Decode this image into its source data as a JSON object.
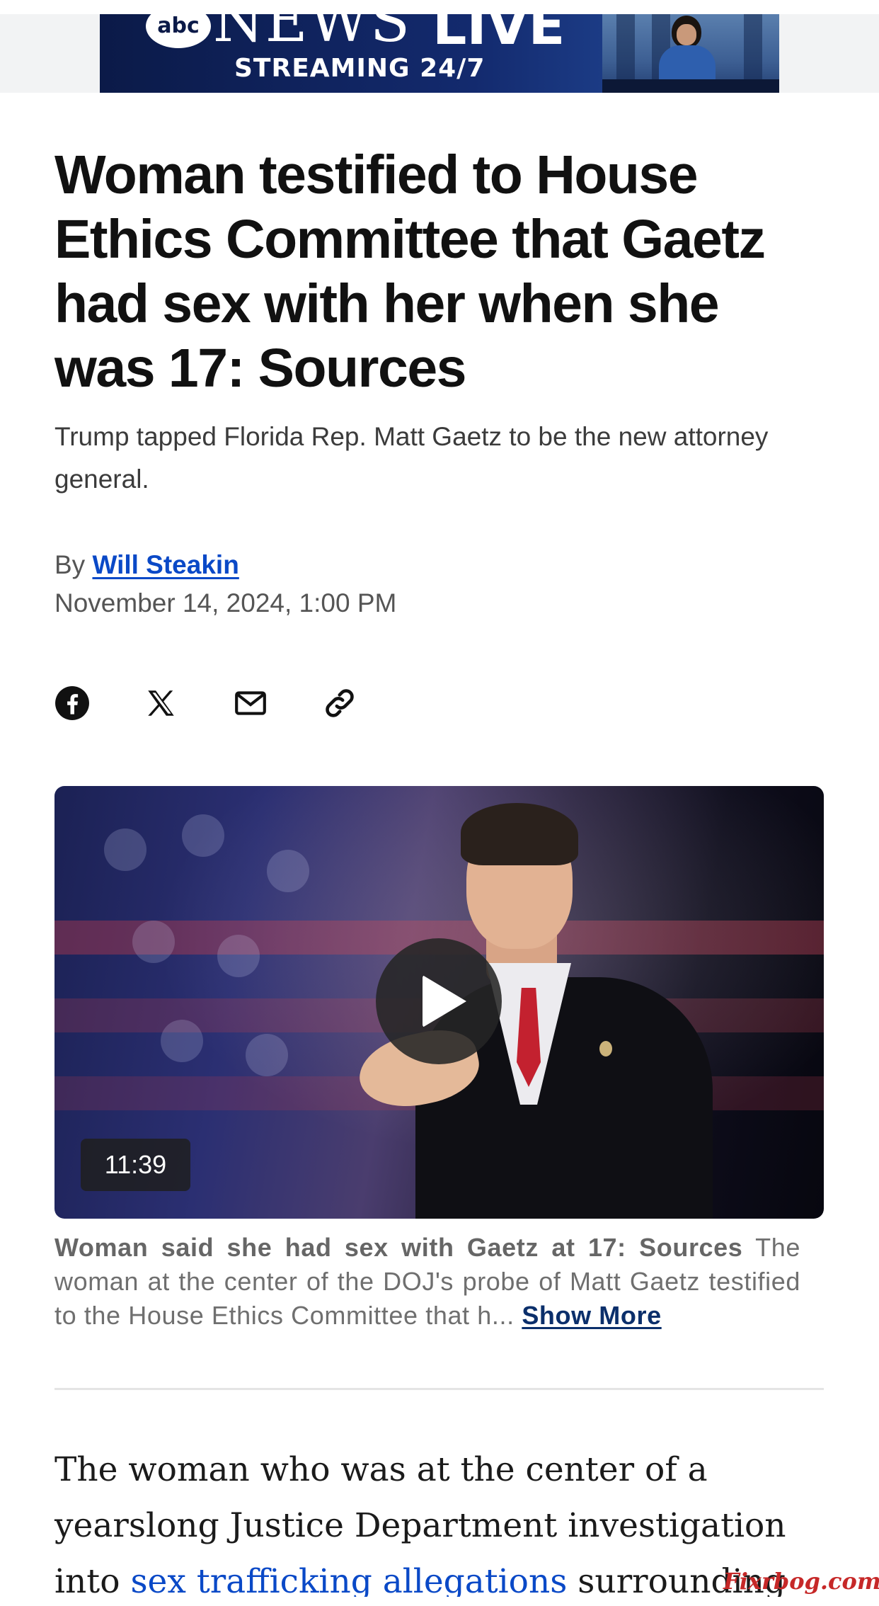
{
  "ad_banner": {
    "logo": "abc",
    "news": "NEWS",
    "live": "LIVE",
    "streaming": "STREAMING 24/7"
  },
  "article": {
    "headline": "Woman testified to House Ethics Committee that Gaetz had sex with her when she was 17: Sources",
    "subheadline": "Trump tapped Florida Rep. Matt Gaetz to be the new attorney general.",
    "byline_prefix": "By",
    "author": "Will Steakin",
    "date": "November 14, 2024, 1:00 PM"
  },
  "share_icons": [
    "facebook-icon",
    "x-icon",
    "email-icon",
    "link-icon"
  ],
  "video": {
    "duration": "11:39",
    "caption_title": "Woman said she had sex with Gaetz at 17: Sources",
    "caption_text": "The woman at the center of the DOJ's probe of Matt Gaetz testified to the House Ethics Committee that h...",
    "show_more_label": "Show More"
  },
  "body": {
    "text_before_link": "The woman who was at the center of a yearslong Justice Department investigation into ",
    "link_text": "sex trafficking allegations",
    "text_after_link": " surrounding Rep. Matt"
  },
  "watermark": "Fixrbog.com",
  "colors": {
    "link_blue": "#0a49c7",
    "show_more_navy": "#0b2f6b",
    "headline": "#111111"
  }
}
